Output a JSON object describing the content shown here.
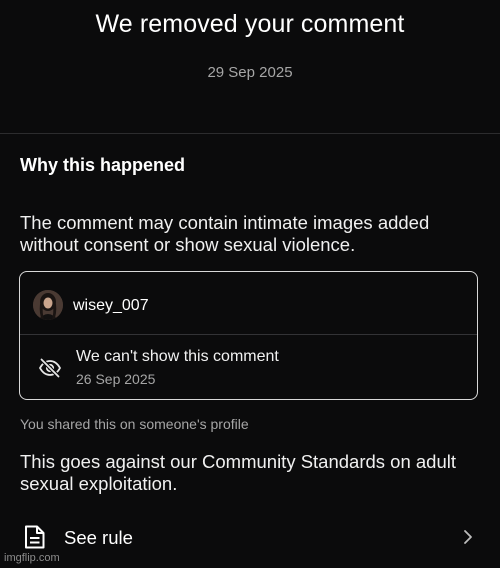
{
  "header": {
    "title": "We removed your comment",
    "date": "29 Sep 2025"
  },
  "why_section": {
    "heading": "Why this happened",
    "reason": "The comment may contain intimate images added without consent or show sexual violence."
  },
  "comment_card": {
    "username": "wisey_007",
    "hidden_title": "We can't show this comment",
    "hidden_date": "26 Sep 2025",
    "hidden_icon": "eye-slash-icon"
  },
  "shared_note": "You shared this on someone's profile",
  "standards_text": "This goes against our Community Standards on adult sexual exploitation.",
  "see_rule": {
    "label": "See rule",
    "icon": "document-icon",
    "chevron": "chevron-right-icon"
  },
  "watermark": "imgflip.com",
  "colors": {
    "background": "#0b0b0c",
    "text_primary": "#ffffff",
    "text_secondary": "#a6a6a6",
    "card_border": "#d9d9d9"
  }
}
